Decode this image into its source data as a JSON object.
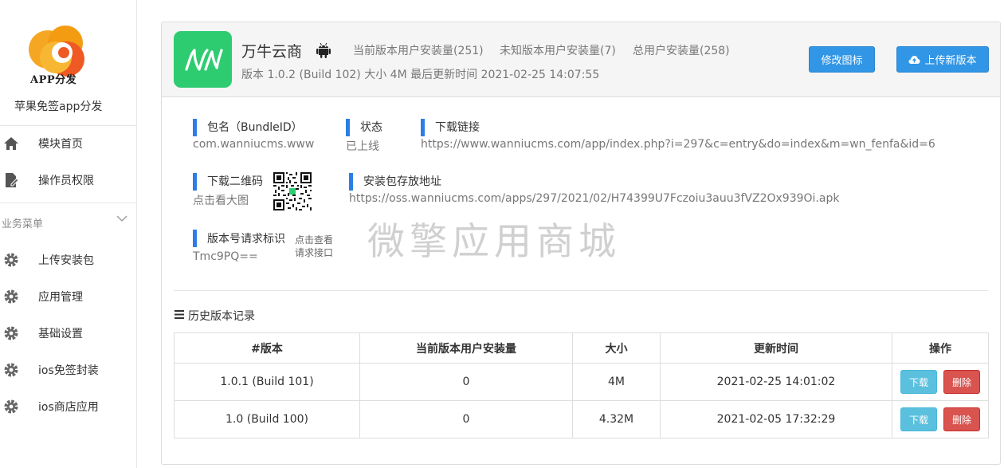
{
  "sidebar": {
    "logo_text": "APP分发",
    "brand": "苹果免签app分发",
    "items": [
      {
        "label": "模块首页",
        "icon": "home-icon"
      },
      {
        "label": "操作员权限",
        "icon": "document-edit-icon"
      }
    ],
    "section_label": "业务菜单",
    "business_items": [
      {
        "label": "上传安装包",
        "icon": "gear-icon"
      },
      {
        "label": "应用管理",
        "icon": "gear-icon"
      },
      {
        "label": "基础设置",
        "icon": "gear-icon"
      },
      {
        "label": "ios免签封装",
        "icon": "gear-icon"
      },
      {
        "label": "ios商店应用",
        "icon": "gear-icon"
      }
    ]
  },
  "app": {
    "name": "万牛云商",
    "current_installs": "当前版本用户安装量(251)",
    "unknown_installs": "未知版本用户安装量(7)",
    "total_installs": "总用户安装量(258)",
    "meta": "版本 1.0.2   (Build 102)   大小 4M   最后更新时间 2021-02-25 14:07:55",
    "edit_icon_button": "修改图标",
    "upload_button": "上传新版本"
  },
  "info": {
    "bundle_label": "包名（BundleID）",
    "bundle_value": "com.wanniucms.www",
    "status_label": "状态",
    "status_value": "已上线",
    "download_link_label": "下载链接",
    "download_link_value": "https://www.wanniucms.com/app/index.php?i=297&c=entry&do=index&m=wn_fenfa&id=6",
    "qr_label": "下载二维码",
    "qr_link": "点击看大图",
    "package_label": "安装包存放地址",
    "package_value": "https://oss.wanniucms.com/apps/297/2021/02/H74399U7Fczoiu3auu3fVZ2Ox939Oi.apk",
    "version_req_label": "版本号请求标识",
    "version_req_value": "Tmc9PQ==",
    "view_link_line1": "点击查看",
    "view_link_line2": "请求接口"
  },
  "watermark": "微擎应用商城",
  "history": {
    "title": "历史版本记录",
    "columns": [
      "#版本",
      "当前版本用户安装量",
      "大小",
      "更新时间",
      "操作"
    ],
    "rows": [
      {
        "version": "1.0.1 (Build 101)",
        "installs": "0",
        "size": "4M",
        "updated": "2021-02-25 14:01:02"
      },
      {
        "version": "1.0 (Build 100)",
        "installs": "0",
        "size": "4.32M",
        "updated": "2021-02-05 17:32:29"
      }
    ],
    "download_label": "下载",
    "delete_label": "删除"
  },
  "colors": {
    "primary": "#3296e6",
    "app_icon_bg": "#2ecc71",
    "info_bar": "#2c7ee6",
    "btn_info": "#5bc0de",
    "btn_danger": "#d9534f"
  }
}
